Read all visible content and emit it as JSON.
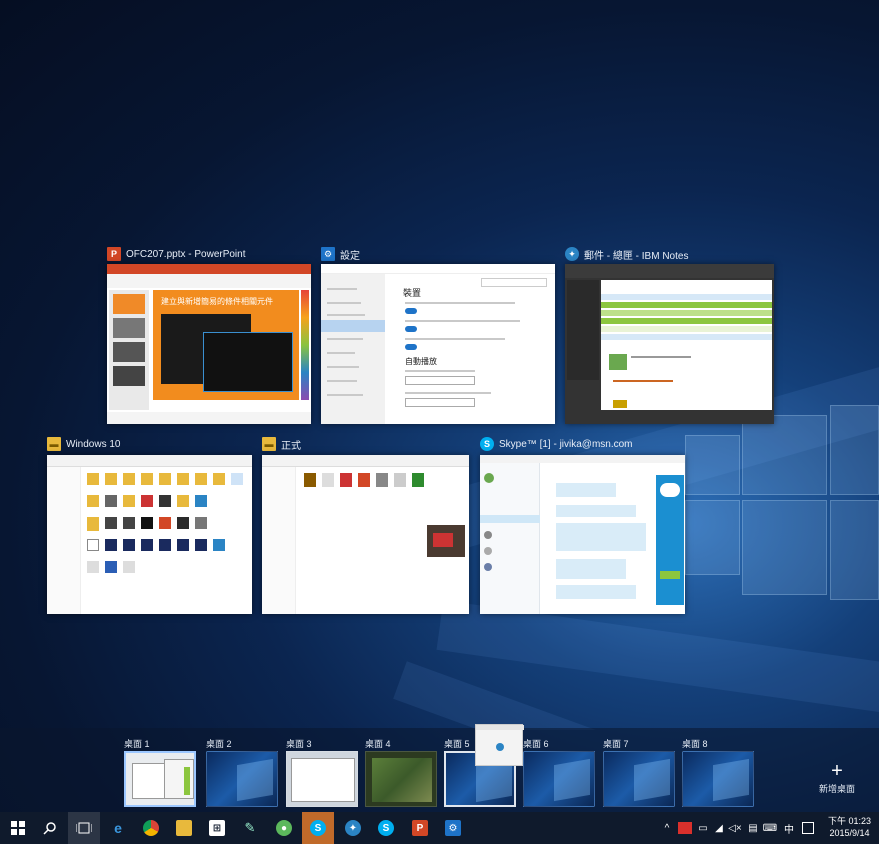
{
  "windows": [
    {
      "title": "OFC207.pptx - PowerPoint",
      "icon": "powerpoint-icon",
      "accent": "#d24726",
      "slide_text": "建立與新增簡易的條件相關元件"
    },
    {
      "title": "設定",
      "icon": "settings-icon",
      "accent": "#1e73c8"
    },
    {
      "title": "郵件 - 總匣 - IBM Notes",
      "icon": "ibm-notes-icon",
      "accent": "#2b84c4"
    },
    {
      "title": "Windows 10",
      "icon": "folder-icon",
      "accent": "#e8b93c"
    },
    {
      "title": "正式",
      "icon": "folder-icon",
      "accent": "#e8b93c"
    },
    {
      "title": "Skype™ [1] - jivika@msn.com",
      "icon": "skype-icon",
      "accent": "#00aff0"
    }
  ],
  "settings_window": {
    "section": "裝置",
    "subheading": "自動播放"
  },
  "desktops": [
    {
      "label": "桌面 1"
    },
    {
      "label": "桌面 2"
    },
    {
      "label": "桌面 3"
    },
    {
      "label": "桌面 4"
    },
    {
      "label": "桌面 5"
    },
    {
      "label": "桌面 6"
    },
    {
      "label": "桌面 7"
    },
    {
      "label": "桌面 8"
    }
  ],
  "new_desktop_label": "新增桌面",
  "taskbar": {
    "clock_time": "下午 01:23",
    "clock_date": "2015/9/14",
    "ime": "中",
    "tray_chevron": "^"
  }
}
